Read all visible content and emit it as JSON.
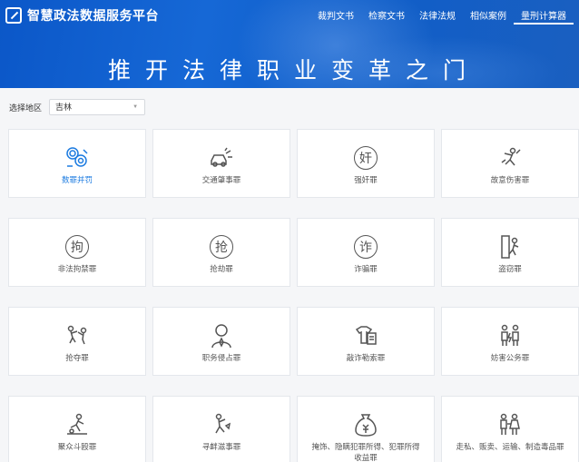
{
  "header": {
    "logo_text": "智慧政法数据服务平台",
    "nav": [
      "裁判文书",
      "检察文书",
      "法律法规",
      "相似案例",
      "量刑计算器"
    ],
    "slogan": "推开法律职业变革之门"
  },
  "filter": {
    "label": "选择地区",
    "value": "吉林"
  },
  "cards": [
    {
      "label": "数罪并罚",
      "icon": "combined-crimes-icon"
    },
    {
      "label": "交通肇事罪",
      "icon": "traffic-accident-icon"
    },
    {
      "label": "强奸罪",
      "icon": "rape-icon",
      "glyph": "奸"
    },
    {
      "label": "故意伤害罪",
      "icon": "intentional-injury-icon"
    },
    {
      "label": "非法拘禁罪",
      "icon": "illegal-detention-icon",
      "glyph": "拘"
    },
    {
      "label": "抢劫罪",
      "icon": "robbery-icon",
      "glyph": "抢"
    },
    {
      "label": "诈骗罪",
      "icon": "fraud-icon",
      "glyph": "诈"
    },
    {
      "label": "盗窃罪",
      "icon": "theft-icon"
    },
    {
      "label": "抢夺罪",
      "icon": "snatching-icon"
    },
    {
      "label": "职务侵占罪",
      "icon": "embezzlement-icon"
    },
    {
      "label": "敲诈勒索罪",
      "icon": "extortion-icon"
    },
    {
      "label": "妨害公务罪",
      "icon": "obstructing-duty-icon"
    },
    {
      "label": "聚众斗殴罪",
      "icon": "gang-fight-icon"
    },
    {
      "label": "寻衅滋事罪",
      "icon": "provocation-icon"
    },
    {
      "label": "掩饰、隐瞒犯罪所得、犯罪所得收益罪",
      "icon": "concealing-proceeds-icon"
    },
    {
      "label": "走私、贩卖、运输、制造毒品罪",
      "icon": "drug-trafficking-icon"
    }
  ],
  "colors": {
    "accent": "#1c7be0",
    "banner": "#1668d6"
  }
}
